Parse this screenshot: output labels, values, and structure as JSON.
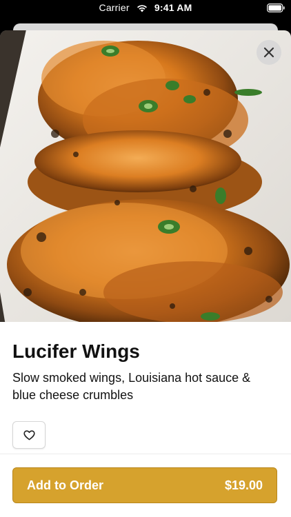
{
  "status_bar": {
    "carrier": "Carrier",
    "time": "9:41 AM",
    "icons": [
      "wifi-icon",
      "battery-icon"
    ]
  },
  "item": {
    "title": "Lucifer Wings",
    "description": "Slow smoked wings, Louisiana hot sauce & blue cheese crumbles",
    "photo": "lucifer-wings-photo"
  },
  "actions": {
    "close_icon": "close-icon",
    "favorite_icon": "heart-icon",
    "add_label": "Add to Order",
    "price": "$19.00"
  },
  "colors": {
    "accent": "#d6a22d",
    "accent_border": "#b8861c"
  }
}
